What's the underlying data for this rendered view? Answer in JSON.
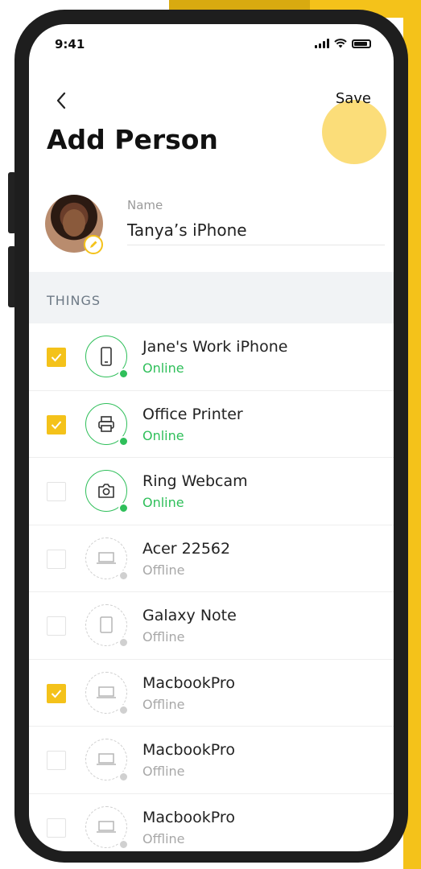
{
  "status_bar": {
    "time": "9:41"
  },
  "header": {
    "title": "Add Person",
    "save_label": "Save"
  },
  "profile": {
    "name_label": "Name",
    "name_value": "Tanya’s iPhone"
  },
  "section": {
    "label": "THINGS"
  },
  "colors": {
    "accent": "#f4c21a",
    "online": "#2fbf5a",
    "offline": "#a8a8a8"
  },
  "things": [
    {
      "name": "Jane's Work iPhone",
      "status": "Online",
      "online": true,
      "checked": true,
      "icon": "phone-icon"
    },
    {
      "name": "Office Printer",
      "status": "Online",
      "online": true,
      "checked": true,
      "icon": "printer-icon"
    },
    {
      "name": "Ring Webcam",
      "status": "Online",
      "online": true,
      "checked": false,
      "icon": "camera-icon"
    },
    {
      "name": "Acer 22562",
      "status": "Offline",
      "online": false,
      "checked": false,
      "icon": "laptop-icon"
    },
    {
      "name": "Galaxy Note",
      "status": "Offline",
      "online": false,
      "checked": false,
      "icon": "tablet-icon"
    },
    {
      "name": "MacbookPro",
      "status": "Offline",
      "online": false,
      "checked": true,
      "icon": "laptop-icon"
    },
    {
      "name": "MacbookPro",
      "status": "Offline",
      "online": false,
      "checked": false,
      "icon": "laptop-icon"
    },
    {
      "name": "MacbookPro",
      "status": "Offline",
      "online": false,
      "checked": false,
      "icon": "laptop-icon"
    }
  ]
}
